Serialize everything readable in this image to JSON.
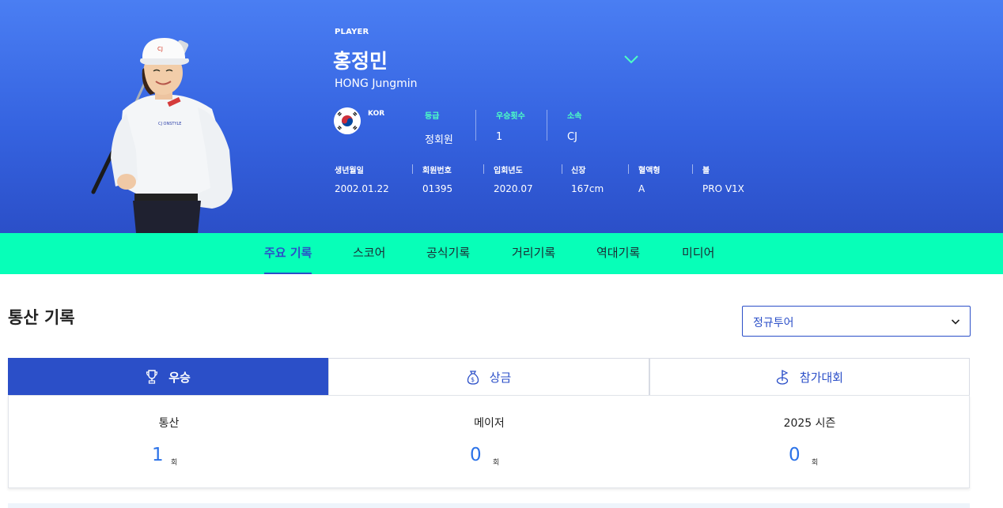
{
  "player": {
    "eyebrow": "PLAYER",
    "name_ko": "홍정민",
    "name_en": "HONG Jungmin",
    "nation": "KOR",
    "stats": [
      {
        "label": "등급",
        "value": "정회원"
      },
      {
        "label": "우승횟수",
        "value": "1"
      },
      {
        "label": "소속",
        "value": "CJ"
      }
    ],
    "info": [
      {
        "label": "생년월일",
        "value": "2002.01.22"
      },
      {
        "label": "회원번호",
        "value": "01395"
      },
      {
        "label": "입회년도",
        "value": "2020.07"
      },
      {
        "label": "신장",
        "value": "167cm"
      },
      {
        "label": "혈액형",
        "value": "A"
      },
      {
        "label": "볼",
        "value": "PRO V1X"
      }
    ]
  },
  "nav": {
    "tabs": [
      "주요 기록",
      "스코어",
      "공식기록",
      "거리기록",
      "역대기록",
      "미디어"
    ],
    "active": "주요 기록"
  },
  "career": {
    "title": "통산 기록",
    "tour_select": "정규투어",
    "category_tabs": [
      {
        "label": "우승",
        "icon": "trophy-icon"
      },
      {
        "label": "상금",
        "icon": "money-bag-icon"
      },
      {
        "label": "참가대회",
        "icon": "golf-flag-icon"
      }
    ],
    "stats": [
      {
        "label": "통산",
        "value": "1",
        "unit": "회"
      },
      {
        "label": "메이저",
        "value": "0",
        "unit": "회"
      },
      {
        "label": "2025 시즌",
        "value": "0",
        "unit": "회"
      }
    ]
  },
  "colors": {
    "brand_blue": "#2b4fc8",
    "accent_mint": "#07ffb8",
    "stat_label": "#4dffc4",
    "number_blue": "#2b72e8"
  }
}
